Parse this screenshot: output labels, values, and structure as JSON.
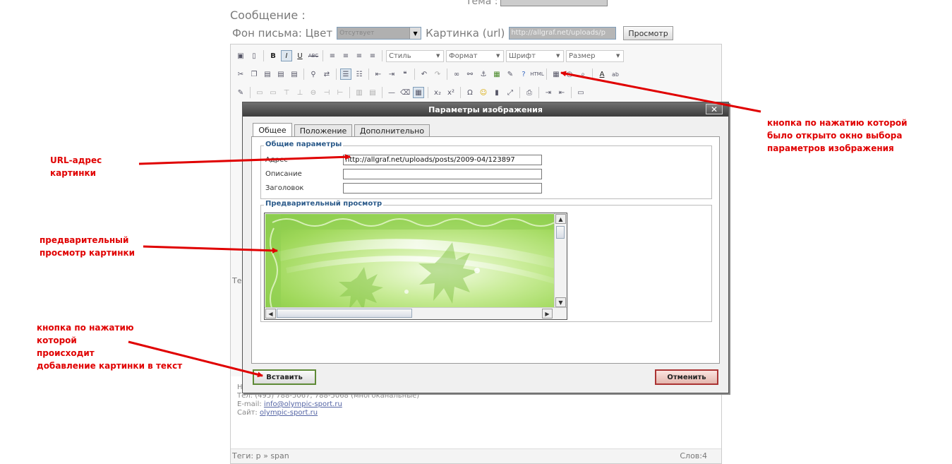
{
  "top_cut": {
    "label": "Тема :"
  },
  "message_label": "Сообщение :",
  "background_row": {
    "label": "Фон письма: Цвет",
    "color_select_value": "Отсутвует",
    "picture_label": "Картинка (url)",
    "picture_url_value": "http://allgraf.net/uploads/p",
    "preview_button": "Просмотр"
  },
  "toolbar": {
    "style_dropdown": "Стиль",
    "format_dropdown": "Формат",
    "font_dropdown": "Шрифт",
    "size_dropdown": "Размер",
    "html_label": "HTML"
  },
  "dialog": {
    "title": "Параметры изображения",
    "close_label": "✕",
    "tabs": [
      {
        "label": "Общее",
        "active": true
      },
      {
        "label": "Положение",
        "active": false
      },
      {
        "label": "Дополнительно",
        "active": false
      }
    ],
    "general_legend": "Общие параметры",
    "fields": [
      {
        "label": "Адрес",
        "value": "http://allgraf.net/uploads/posts/2009-04/123897"
      },
      {
        "label": "Описание",
        "value": ""
      },
      {
        "label": "Заголовок",
        "value": ""
      }
    ],
    "preview_legend": "Предварительный просмотр",
    "insert_button": "Вставить",
    "cancel_button": "Отменить"
  },
  "editor_content": {
    "side_left_label": "Тег",
    "left_fragment": "Н",
    "phone_line": "Тел: (495) 788-5067, 788-5068 (многоканальные)",
    "email_label": "E-mail:",
    "email_link": "info@olympic-sport.ru",
    "site_label": "Сайт:",
    "site_link": "olympic-sport.ru"
  },
  "statusbar": {
    "path": "Теги: p » span",
    "words": "Слов:4"
  },
  "annotations": {
    "url": "URL-адрес\nкартинки",
    "preview": "предварительный\nпросмотр картинки",
    "insert": "кнопка по нажатию\nкоторой\nпроисходит\nдобавление картинки в текст",
    "opener": "кнопка по нажатию которой\nбыло открыто окно выбора\nпараметров изображения"
  },
  "colors": {
    "annotation": "#e00000",
    "dialog_title_bar": "#4a4a4a",
    "legend_text": "#2b5a8a"
  }
}
